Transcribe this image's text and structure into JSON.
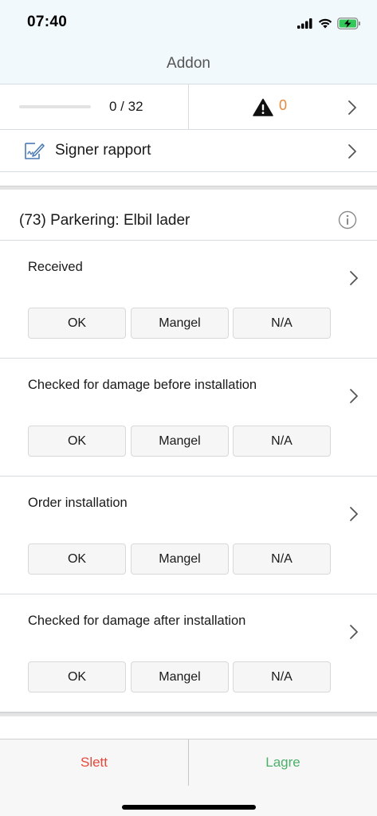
{
  "status_bar": {
    "time": "07:40",
    "icons": [
      "signal-icon",
      "wifi-icon",
      "battery-charging-icon"
    ]
  },
  "nav": {
    "title": "Addon"
  },
  "summary": {
    "progress_text": "0 / 32",
    "progress_fraction": 0,
    "warning_count": "0",
    "warning_color": "#e8883a"
  },
  "sign": {
    "label": "Signer rapport"
  },
  "section": {
    "title": "(73) Parkering: Elbil lader"
  },
  "items": [
    {
      "title": "Received",
      "buttons": [
        "OK",
        "Mangel",
        "N/A"
      ]
    },
    {
      "title": "Checked for damage before installation",
      "buttons": [
        "OK",
        "Mangel",
        "N/A"
      ]
    },
    {
      "title": "Order installation",
      "buttons": [
        "OK",
        "Mangel",
        "N/A"
      ]
    },
    {
      "title": "Checked for damage after installation",
      "buttons": [
        "OK",
        "Mangel",
        "N/A"
      ]
    }
  ],
  "footer": {
    "delete_label": "Slett",
    "save_label": "Lagre",
    "delete_color": "#e8473a",
    "save_color": "#4caf6a"
  }
}
